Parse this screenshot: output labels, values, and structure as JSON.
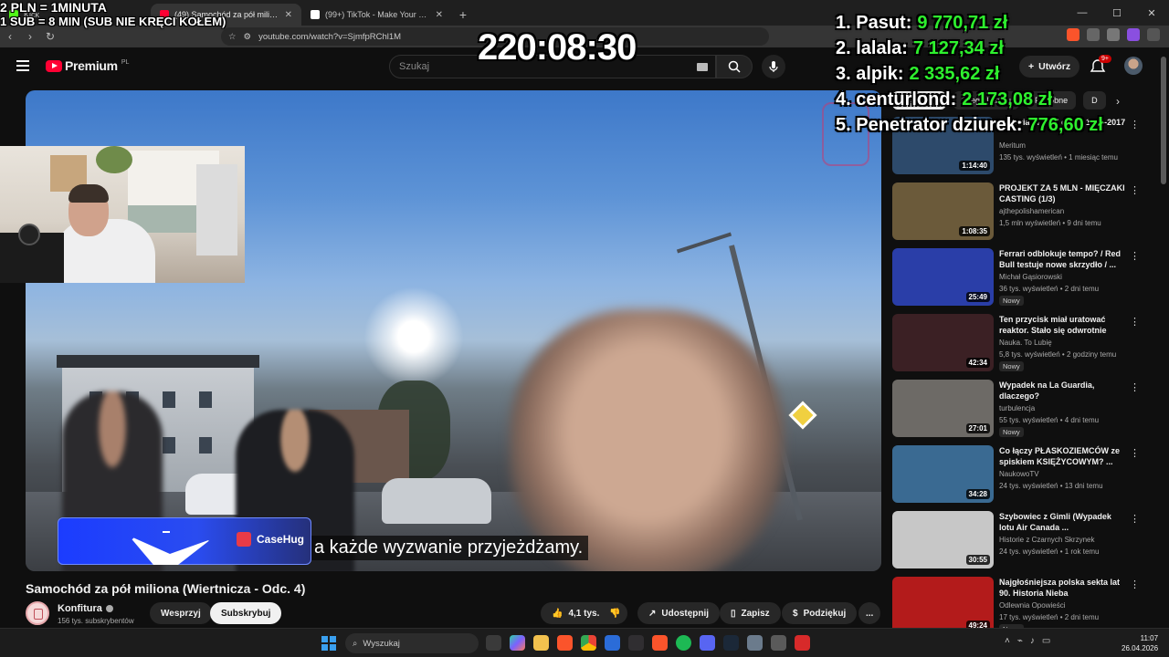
{
  "browser": {
    "tabs": [
      {
        "title": "Kick",
        "active": false,
        "color": "#53fc18"
      },
      {
        "title": "(49) Samochód za pół miliona",
        "active": true,
        "color": "#ff0033"
      },
      {
        "title": "(99+) TikTok - Make Your Day",
        "active": false,
        "color": "#ffffff"
      }
    ],
    "new_tab": "+",
    "url": "youtube.com/watch?v=SjmfpRChl1M"
  },
  "youtube": {
    "logo": "Premium",
    "logo_country": "PL",
    "search_placeholder": "Szukaj",
    "create_label": "Utwórz",
    "notif_count": "9+"
  },
  "video": {
    "subtitle": "a każde wyzwanie przyjeżdżamy.",
    "sponsor": "CaseHug",
    "title": "Samochód za pół miliona (Wiertnicza - Odc. 4)",
    "channel": "Konfitura",
    "subscribers": "156 tys. subskrybentów",
    "join_label": "Wesprzyj",
    "subscribe_label": "Subskrybuj",
    "likes": "4,1 tys.",
    "share_label": "Udostępnij",
    "save_label": "Zapisz",
    "thanks_label": "Podziękuj",
    "more": "..."
  },
  "chips": [
    {
      "label": "Wszystkie",
      "active": true
    },
    {
      "label": "Z tego kanału",
      "active": false
    },
    {
      "label": "Podobne",
      "active": false
    },
    {
      "label": "D",
      "active": false
    }
  ],
  "recommendations": [
    {
      "title": "Historia Francji cz. 3 | 1875-2017",
      "channel": "Meritum",
      "meta": "135 tys. wyświetleń • 1 miesiąc temu",
      "duration": "1:14:40",
      "badge": "",
      "bg": "#2d4a6b"
    },
    {
      "title": "PROJEKT ZA 5 MLN - MIĘCZAKI CASTING (1/3)",
      "channel": "ajthepolishamerican",
      "meta": "1,5 mln wyświetleń • 9 dni temu",
      "duration": "1:08:35",
      "badge": "",
      "bg": "#6b5a3a"
    },
    {
      "title": "Ferrari odblokuje tempo? / Red Bull testuje nowe skrzydło / ...",
      "channel": "Michał Gąsiorowski",
      "meta": "36 tys. wyświetleń • 2 dni temu",
      "duration": "25:49",
      "badge": "Nowy",
      "bg": "#2a3ea8"
    },
    {
      "title": "Ten przycisk miał uratować reaktor. Stało się odwrotnie",
      "channel": "Nauka. To Lubię",
      "meta": "5,8 tys. wyświetleń • 2 godziny temu",
      "duration": "42:34",
      "badge": "Nowy",
      "bg": "#3b2024"
    },
    {
      "title": "Wypadek na La Guardia, dlaczego?",
      "channel": "turbulencja",
      "meta": "55 tys. wyświetleń • 4 dni temu",
      "duration": "27:01",
      "badge": "Nowy",
      "bg": "#6d6a66"
    },
    {
      "title": "Co łączy PŁASKOZIEMCÓW ze spiskiem KSIĘŻYCOWYM? ...",
      "channel": "NaukowoTV",
      "meta": "24 tys. wyświetleń • 13 dni temu",
      "duration": "34:28",
      "badge": "",
      "bg": "#3a6a92"
    },
    {
      "title": "Szybowiec z Gimli (Wypadek lotu Air Canada ...",
      "channel": "Historie z Czarnych Skrzynek",
      "meta": "24 tys. wyświetleń • 1 rok temu",
      "duration": "30:55",
      "badge": "",
      "bg": "#c7c7c7"
    },
    {
      "title": "Najgłośniejsza polska sekta lat 90. Historia Nieba",
      "channel": "Odlewnia Opowieści",
      "meta": "17 tys. wyświetleń • 2 dni temu",
      "duration": "49:24",
      "badge": "Nowy",
      "bg": "#b31b1b"
    }
  ],
  "overlay": {
    "rate_line1": "2 PLN = 1MINUTA",
    "rate_line2": "1 SUB = 8 MIN (SUB NIE KRĘCI KOŁEM)",
    "timer": "220:08:30",
    "leaderboard": [
      {
        "rank": "1. Pasut:",
        "amount": "9 770,71 zł"
      },
      {
        "rank": "2. lalala:",
        "amount": "7 127,34 zł"
      },
      {
        "rank": "3. alpik:",
        "amount": "2 335,62 zł"
      },
      {
        "rank": "4. centurlond:",
        "amount": "2 173,08 zł"
      },
      {
        "rank": "5. Penetrator dziurek:",
        "amount": "776,60 zł"
      }
    ]
  },
  "taskbar": {
    "search_placeholder": "Wyszukaj",
    "time": "11:07",
    "date": "26.04.2026"
  },
  "colors": {
    "yt_red": "#ff0033",
    "leaderboard_green": "#2ef02e",
    "sponsor_blue": "#1b3cff"
  }
}
